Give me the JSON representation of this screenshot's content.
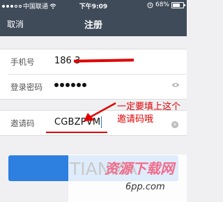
{
  "status_bar": {
    "carrier": "中国联通",
    "time": "下午9:09",
    "battery": "68%",
    "battery_level": 0.68
  },
  "nav": {
    "cancel_label": "取消",
    "title": "注册"
  },
  "form": {
    "phone": {
      "label": "手机号",
      "value": "186 3"
    },
    "password": {
      "label": "登录密码",
      "masked_count": 6
    },
    "invite": {
      "label": "邀请码",
      "value": "CGBZPVM"
    }
  },
  "annotation": {
    "text": "一定要填上这个邀请码哦",
    "color": "#e00000"
  },
  "submit_button": {
    "color": "#2d7fe0"
  },
  "watermark": {
    "latin": "TIANMA",
    "chinese": "资源下载网",
    "url": "6pp.com"
  }
}
